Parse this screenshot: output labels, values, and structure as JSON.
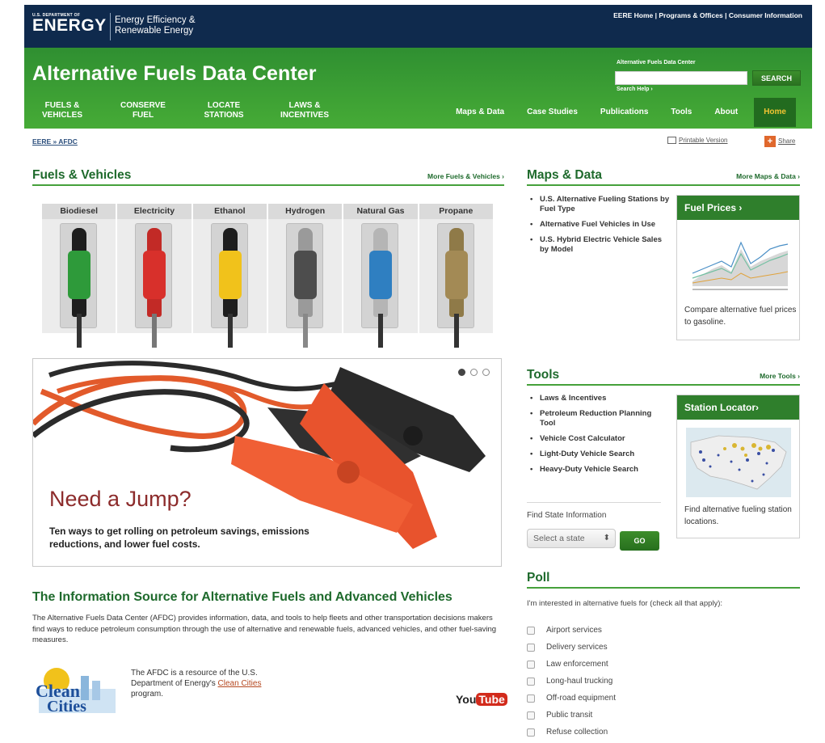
{
  "topbar": {
    "doe_small": "U.S. DEPARTMENT OF",
    "doe_big": "ENERGY",
    "eere_title": "Energy Efficiency & Renewable Energy",
    "links": [
      "EERE Home",
      "Programs & Offices",
      "Consumer Information"
    ]
  },
  "header": {
    "title": "Alternative Fuels Data Center",
    "search_label": "Alternative Fuels Data Center",
    "search_placeholder": "",
    "search_button": "SEARCH",
    "search_help": "Search Help ›"
  },
  "nav_left": [
    "FUELS & VEHICLES",
    "CONSERVE FUEL",
    "LOCATE STATIONS",
    "LAWS & INCENTIVES"
  ],
  "nav_right": [
    "Maps & Data",
    "Case Studies",
    "Publications",
    "Tools",
    "About",
    "Home"
  ],
  "breadcrumb": "EERE » AFDC",
  "printable": "Printable Version",
  "share": "Share",
  "fuels_section": {
    "title": "Fuels & Vehicles",
    "more": "More Fuels & Vehicles ›",
    "tiles": [
      {
        "label": "Biodiesel",
        "color": "#2e9a3a"
      },
      {
        "label": "Electricity",
        "color": "#d8302b"
      },
      {
        "label": "Ethanol",
        "color": "#f1c21b"
      },
      {
        "label": "Hydrogen",
        "color": "#5a5a5a"
      },
      {
        "label": "Natural Gas",
        "color": "#2f7fc1"
      },
      {
        "label": "Propane",
        "color": "#a38a55"
      }
    ]
  },
  "hero": {
    "headline": "Need a Jump?",
    "subtext": "Ten ways to get rolling on petroleum savings, emissions reductions, and lower fuel costs."
  },
  "info": {
    "title": "The Information Source for Alternative Fuels and Advanced Vehicles",
    "body": "The Alternative Fuels Data Center (AFDC) provides information, data, and tools to help fleets and other transportation decisions makers find ways to reduce petroleum consumption through the use of alternative and renewable fuels, advanced vehicles, and other fuel-saving measures.",
    "cc_text": "The AFDC is a resource of the U.S. Department of Energy's",
    "cc_link": "Clean Cities",
    "cc_tail": " program.",
    "cc_logo_1": "Clean",
    "cc_logo_2": "Cities",
    "yt_you": "You",
    "yt_tube": "Tube"
  },
  "maps": {
    "title": "Maps & Data",
    "more": "More Maps & Data ›",
    "links": [
      "U.S. Alternative Fueling Stations by Fuel Type",
      "Alternative Fuel Vehicles in Use",
      "U.S. Hybrid Electric Vehicle Sales by Model"
    ],
    "card_title": "Fuel Prices ›",
    "card_text": "Compare alternative fuel prices to gasoline."
  },
  "tools": {
    "title": "Tools",
    "more": "More Tools ›",
    "links": [
      "Laws & Incentives",
      "Petroleum Reduction Planning Tool",
      "Vehicle Cost Calculator",
      "Light-Duty Vehicle Search",
      "Heavy-Duty Vehicle Search"
    ],
    "card_title": "Station Locator›",
    "card_text": "Find alternative fueling station locations.",
    "state_label": "Find State Information",
    "state_select": "Select a state",
    "go": "GO"
  },
  "poll": {
    "title": "Poll",
    "question": "I'm interested in alternative fuels for (check all that apply):",
    "options": [
      "Airport services",
      "Delivery services",
      "Law enforcement",
      "Long-haul trucking",
      "Off-road equipment",
      "Public transit",
      "Refuse collection"
    ]
  }
}
